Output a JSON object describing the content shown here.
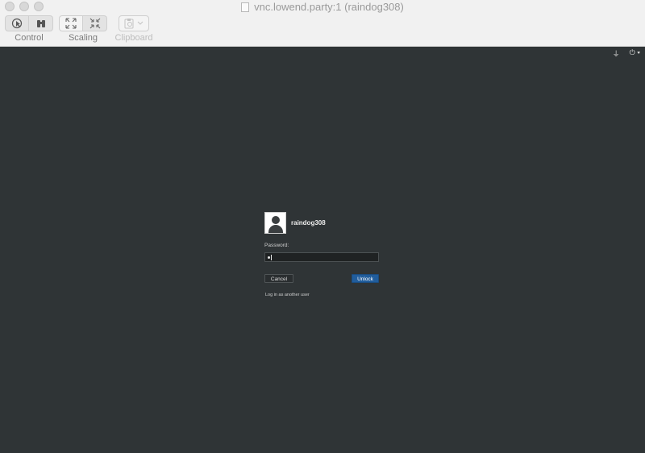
{
  "window": {
    "title": "vnc.lowend.party:1 (raindog308)"
  },
  "toolbar": {
    "control_label": "Control",
    "scaling_label": "Scaling",
    "clipboard_label": "Clipboard"
  },
  "login": {
    "username": "raindog308",
    "password_label": "Password:",
    "password_masked": "•",
    "cancel_label": "Cancel",
    "unlock_label": "Unlock",
    "other_user_link": "Log in as another user"
  },
  "colors": {
    "desktop_bg": "#2f3436",
    "unlock_button": "#215d9c",
    "titlebar_bg": "#f1f1f1"
  }
}
